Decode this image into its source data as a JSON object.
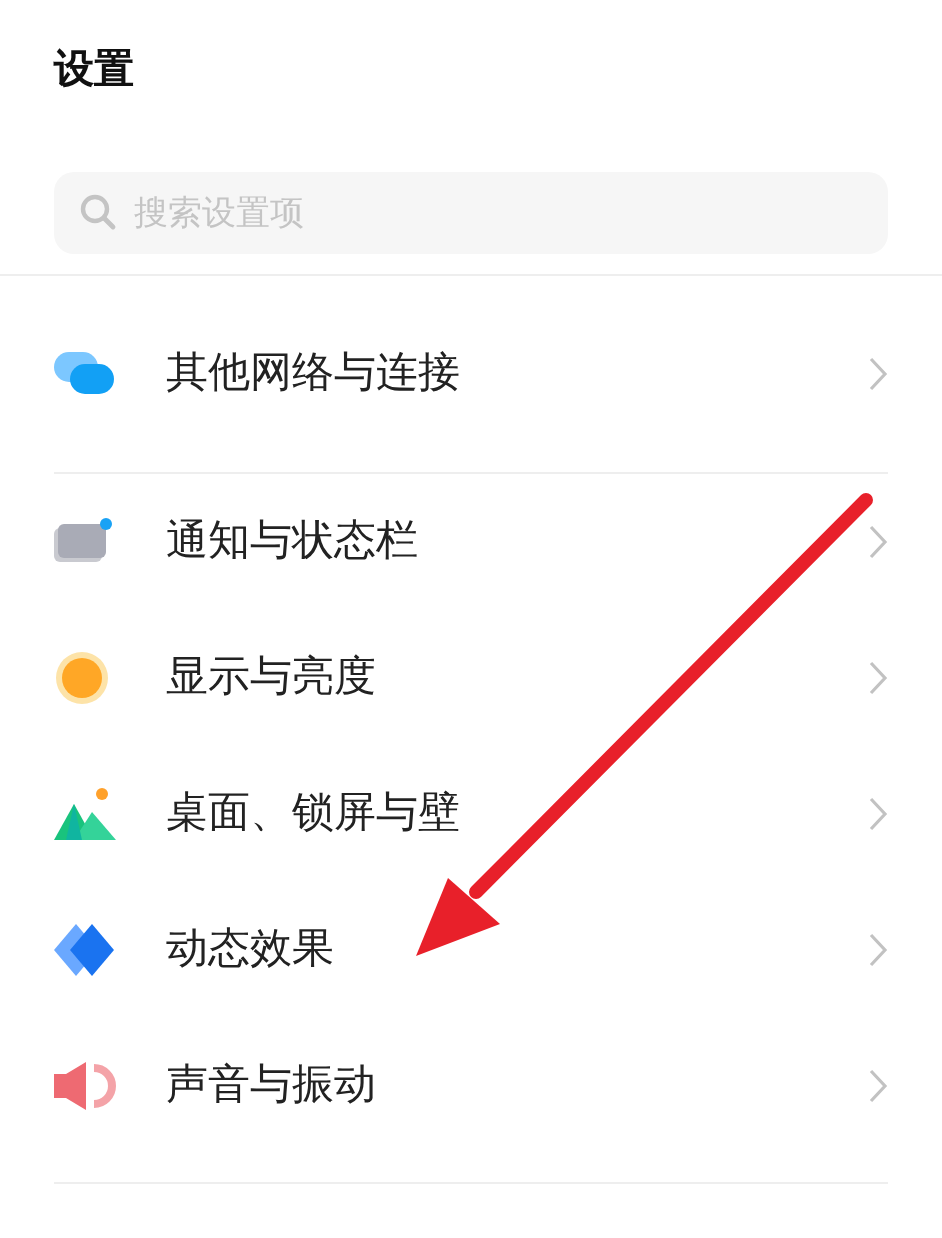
{
  "header": {
    "title": "设置"
  },
  "search": {
    "placeholder": "搜索设置项"
  },
  "groups": [
    {
      "items": [
        {
          "kind": "network",
          "label": "其他网络与连接"
        }
      ]
    },
    {
      "items": [
        {
          "kind": "notification",
          "label": "通知与状态栏"
        },
        {
          "kind": "display",
          "label": "显示与亮度"
        },
        {
          "kind": "wallpaper",
          "label": "桌面、锁屏与壁"
        },
        {
          "kind": "animation",
          "label": "动态效果"
        },
        {
          "kind": "sound",
          "label": "声音与振动"
        }
      ]
    }
  ],
  "annotation": {
    "kind": "arrow",
    "color": "#e8202a"
  }
}
